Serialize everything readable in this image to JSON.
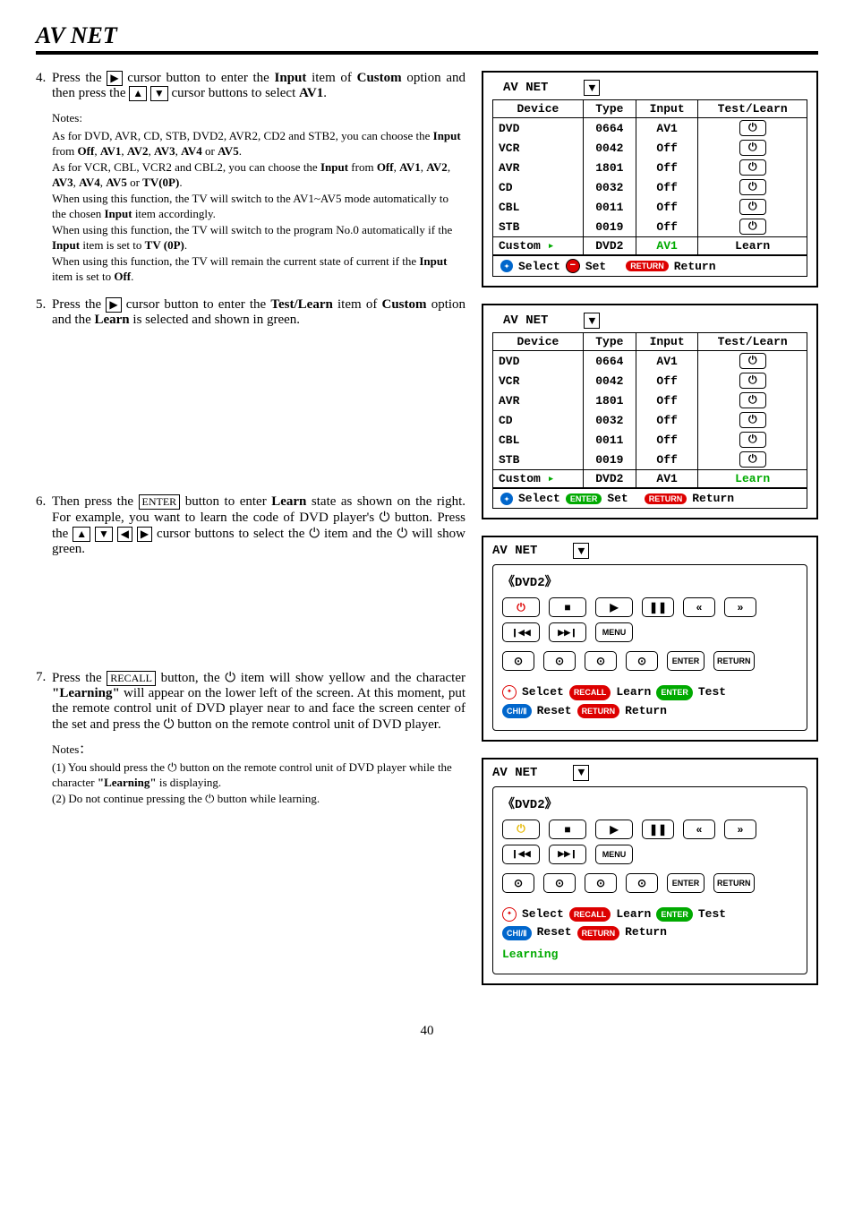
{
  "page_title": "AV NET",
  "page_number": "40",
  "step4": {
    "num": "4.",
    "text_before_box1": "Press the ",
    "box1": "▶",
    "text_mid1": " cursor button to enter the ",
    "bold1": "Input",
    "text_mid2": " item of ",
    "bold2": "Custom",
    "text_mid3": " option and then press the ",
    "box2": "▲",
    "box3": "▼",
    "text_mid4": " cursor buttons to select ",
    "bold3": "AV1",
    "text_end": "."
  },
  "notes4": {
    "hdr": "Notes:",
    "l1a": "As for DVD, AVR, CD, STB, DVD2, AVR2, CD2 and STB2, you can choose the ",
    "l1b": "Input",
    "l1c": " from ",
    "l1d": "Off",
    "l1e": ", ",
    "l1f": "AV1",
    "l1g": ", ",
    "l1h": "AV2",
    "l1i": ", ",
    "l1j": "AV3",
    "l1k": ", ",
    "l1l": "AV4",
    "l1m": " or ",
    "l1n": "AV5",
    "l1o": ".",
    "l2a": "As for VCR, CBL, VCR2 and CBL2, you can choose the ",
    "l2b": "Input",
    "l2c": " from ",
    "l2d": "Off",
    "l2e": ", ",
    "l2f": "AV1",
    "l2g": ", ",
    "l2h": "AV2",
    "l2i": ", ",
    "l2j": "AV3",
    "l2k": ", ",
    "l2l": "AV4",
    "l2m": ", ",
    "l2n": "AV5",
    "l2o": " or ",
    "l2p": "TV(0P)",
    "l2q": ".",
    "l3a": "When using this function, the TV will switch to the AV1~AV5 mode automatically to the chosen ",
    "l3b": "Input",
    "l3c": " item accordingly.",
    "l4a": "When using this function, the TV will switch to the program No.0 automatically if the ",
    "l4b": "Input",
    "l4c": " item is set to ",
    "l4d": "TV (0P)",
    "l4e": ".",
    "l5a": "When using this function, the TV will remain the current state of current if the ",
    "l5b": "Input",
    "l5c": " item is set to ",
    "l5d": "Off",
    "l5e": "."
  },
  "step5": {
    "num": "5.",
    "t1": "Press the ",
    "box1": "▶",
    "t2": " cursor button to enter the ",
    "b1": "Test/Learn",
    "t3": " item of ",
    "b2": "Custom",
    "t4": " option and the ",
    "b3": "Learn",
    "t5": " is selected and shown in green."
  },
  "step6": {
    "num": "6.",
    "t1": "Then press the ",
    "box1": "ENTER",
    "t2": " button to enter ",
    "b1": "Learn",
    "t3": " state as shown on the right. For example, you want to learn the code of DVD player's ",
    "pwr1": "⏻",
    "t4": " button. Press the ",
    "boxA": "▲",
    "boxB": "▼",
    "boxC": "◀",
    "boxD": "▶",
    "t5": " cursor buttons to select the ",
    "pwr2": "⏻",
    "t6": " item and the ",
    "pwr3": "⏻",
    "t7": " will show green."
  },
  "step7": {
    "num": "7.",
    "t1": "Press the ",
    "box1": "RECALL",
    "t2": " button, the ",
    "pwr1": "⏻",
    "t3": " item will show yellow and the character ",
    "b1": "\"Learning\"",
    "t4": " will appear on the lower left of the screen. At this moment, put the remote control unit of DVD player near to and face the screen center of the set and press the ",
    "pwr2": "⏻",
    "t5": " button on the remote control unit of DVD player."
  },
  "notes7": {
    "hdr": "Notes：",
    "n1a": "(1) You should press the  ",
    "n1pwr": "⏻",
    "n1b": "  button on the remote control unit of DVD player while the character ",
    "n1c": "\"Learning\"",
    "n1d": " is displaying.",
    "n2a": "(2) Do not continue pressing the ",
    "n2pwr": "⏻",
    "n2b": "  button while learning."
  },
  "osd_header_cols": {
    "device": "Device",
    "type": "Type",
    "input": "Input",
    "test": "Test/Learn"
  },
  "osd1": {
    "title": "AV NET",
    "rows": [
      {
        "d": "DVD",
        "t": "0664",
        "i": "AV1"
      },
      {
        "d": "VCR",
        "t": "0042",
        "i": "Off"
      },
      {
        "d": "AVR",
        "t": "1801",
        "i": "Off"
      },
      {
        "d": "CD",
        "t": "0032",
        "i": "Off"
      },
      {
        "d": "CBL",
        "t": "0011",
        "i": "Off"
      },
      {
        "d": "STB",
        "t": "0019",
        "i": "Off"
      }
    ],
    "custom": {
      "d": "Custom",
      "arrow": "▸",
      "t": "DVD2",
      "i": "AV1",
      "tl": "Learn"
    },
    "footer": {
      "select": "Select",
      "set": "Set",
      "return_pill": "RETURN",
      "return": "Return"
    }
  },
  "osd2": {
    "title": "AV NET",
    "rows": [
      {
        "d": "DVD",
        "t": "0664",
        "i": "AV1"
      },
      {
        "d": "VCR",
        "t": "0042",
        "i": "Off"
      },
      {
        "d": "AVR",
        "t": "1801",
        "i": "Off"
      },
      {
        "d": "CD",
        "t": "0032",
        "i": "Off"
      },
      {
        "d": "CBL",
        "t": "0011",
        "i": "Off"
      },
      {
        "d": "STB",
        "t": "0019",
        "i": "Off"
      }
    ],
    "custom": {
      "d": "Custom",
      "arrow": "▸",
      "t": "DVD2",
      "i": "AV1",
      "tl": "Learn"
    },
    "footer": {
      "select": "Select",
      "set_pill": "ENTER",
      "set": "Set",
      "return_pill": "RETURN",
      "return": "Return"
    }
  },
  "fig3": {
    "title": "AV NET",
    "device": "《DVD2》",
    "power": "⏻",
    "row1": {
      "stop": "■",
      "play": "▶",
      "pause": "❚❚",
      "rew": "«",
      "ff": "»"
    },
    "row1b": {
      "prev": "❙◀◀",
      "next": "▶▶❙",
      "menu": "MENU"
    },
    "row2": {
      "a": "⊙",
      "b": "⊙",
      "c": "⊙",
      "d": "⊙",
      "enter": "ENTER",
      "return": "RETURN"
    },
    "legend": {
      "sel": "Selcet",
      "recall": "RECALL",
      "learn": "Learn",
      "enter": "ENTER",
      "test": "Test",
      "ch": "CHⅠ/Ⅱ",
      "reset": "Reset",
      "ret_pill": "RETURN",
      "ret": "Return"
    }
  },
  "fig4": {
    "title": "AV NET",
    "device": "《DVD2》",
    "power": "⏻",
    "row1": {
      "stop": "■",
      "play": "▶",
      "pause": "❚❚",
      "rew": "«",
      "ff": "»"
    },
    "row1b": {
      "prev": "❙◀◀",
      "next": "▶▶❙",
      "menu": "MENU"
    },
    "row2": {
      "a": "⊙",
      "b": "⊙",
      "c": "⊙",
      "d": "⊙",
      "enter": "ENTER",
      "return": "RETURN"
    },
    "legend": {
      "sel": "Select",
      "recall": "RECALL",
      "learn": "Learn",
      "enter": "ENTER",
      "test": "Test",
      "ch": "CHⅠ/Ⅱ",
      "reset": "Reset",
      "ret_pill": "RETURN",
      "ret": "Return",
      "learning": "Learning"
    }
  },
  "icons": {
    "power": "⏻",
    "down": "▼",
    "minus": "−",
    "compass": "✦"
  }
}
